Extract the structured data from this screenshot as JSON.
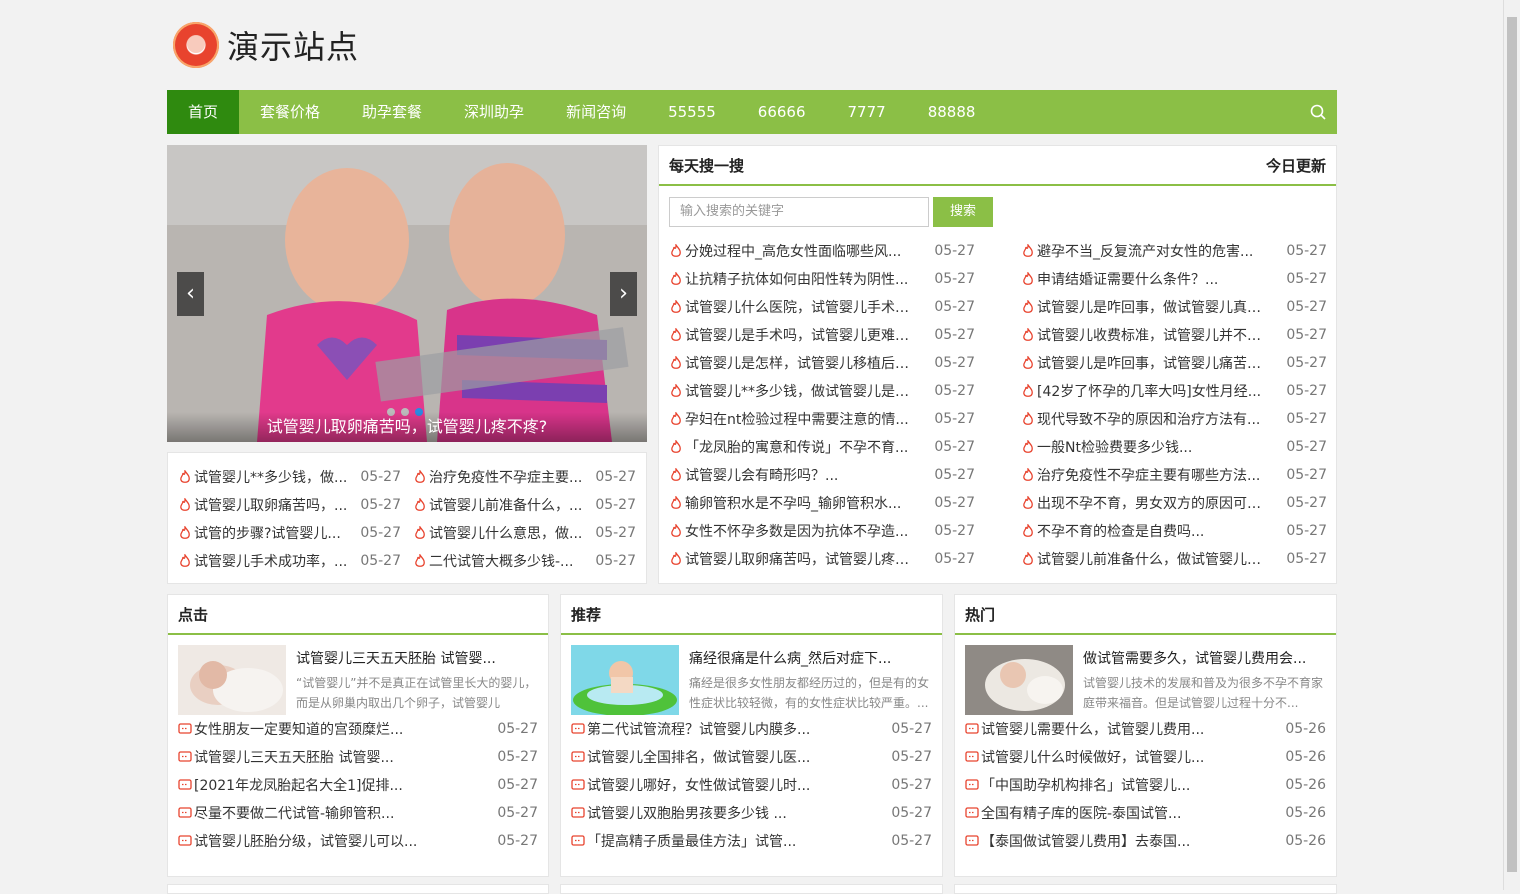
{
  "site": {
    "logo_text": "演示站点"
  },
  "nav": {
    "items": [
      "首页",
      "套餐价格",
      "助孕套餐",
      "深圳助孕",
      "新闻咨询",
      "55555",
      "66666",
      "7777",
      "88888"
    ]
  },
  "slider": {
    "caption": "试管婴儿取卵痛苦吗，试管婴儿疼不疼?",
    "prev": "‹",
    "next": "›"
  },
  "slider_list": [
    {
      "title": "试管婴儿**多少钱，做...",
      "date": "05-27"
    },
    {
      "title": "治疗免疫性不孕症主要...",
      "date": "05-27"
    },
    {
      "title": "试管婴儿取卵痛苦吗，...",
      "date": "05-27"
    },
    {
      "title": "试管婴儿前准备什么，...",
      "date": "05-27"
    },
    {
      "title": "试管的步骤?试管婴儿...",
      "date": "05-27"
    },
    {
      "title": "试管婴儿什么意思，做...",
      "date": "05-27"
    },
    {
      "title": "试管婴儿手术成功率，...",
      "date": "05-27"
    },
    {
      "title": "二代试管大概多少钱-...",
      "date": "05-27"
    }
  ],
  "daily": {
    "title": "每天搜一搜",
    "update": "今日更新",
    "search_placeholder": "输入搜索的关键字",
    "search_button": "搜索",
    "left": [
      {
        "title": "分娩过程中_高危女性面临哪些风...",
        "date": "05-27"
      },
      {
        "title": "让抗精子抗体如何由阳性转为阴性...",
        "date": "05-27"
      },
      {
        "title": "试管婴儿什么医院，试管婴儿手术总...",
        "date": "05-27"
      },
      {
        "title": "试管婴儿是手术吗，试管婴儿更难敷...",
        "date": "05-27"
      },
      {
        "title": "试管婴儿是怎样，试管婴儿移植后腹...",
        "date": "05-27"
      },
      {
        "title": "试管婴儿**多少钱，做试管婴儿是不...",
        "date": "05-27"
      },
      {
        "title": "孕妇在nt检验过程中需要注意的情...",
        "date": "05-27"
      },
      {
        "title": "「龙凤胎的寓意和传说」不孕不育...",
        "date": "05-27"
      },
      {
        "title": "试管婴儿会有畸形吗？...",
        "date": "05-27"
      },
      {
        "title": "输卵管积水是不孕吗_输卵管积水...",
        "date": "05-27"
      },
      {
        "title": "女性不怀孕多数是因为抗体不孕造...",
        "date": "05-27"
      },
      {
        "title": "试管婴儿取卵痛苦吗，试管婴儿疼不...",
        "date": "05-27"
      }
    ],
    "right": [
      {
        "title": "避孕不当_反复流产对女性的危害...",
        "date": "05-27"
      },
      {
        "title": "申请结婚证需要什么条件？...",
        "date": "05-27"
      },
      {
        "title": "试管婴儿是咋回事，做试管婴儿真的...",
        "date": "05-27"
      },
      {
        "title": "试管婴儿收费标准，试管婴儿并不可...",
        "date": "05-27"
      },
      {
        "title": "试管婴儿是咋回事，试管婴儿痛苦与...",
        "date": "05-27"
      },
      {
        "title": "[42岁了怀孕的几率大吗]女性月经...",
        "date": "05-27"
      },
      {
        "title": "现代导致不孕的原因和治疗方法有...",
        "date": "05-27"
      },
      {
        "title": "一般Nt检验费要多少钱...",
        "date": "05-27"
      },
      {
        "title": "治疗免疫性不孕症主要有哪些方法...",
        "date": "05-27"
      },
      {
        "title": "出现不孕不育，男女双方的原因可能...",
        "date": "05-27"
      },
      {
        "title": "不孕不育的检查是自费吗...",
        "date": "05-27"
      },
      {
        "title": "试管婴儿前准备什么，做试管婴儿有...",
        "date": "05-27"
      }
    ]
  },
  "columns": [
    {
      "title": "点击",
      "feature": {
        "title": "试管婴儿三天五天胚胎 试管婴...",
        "desc": "“试管婴儿”并不是真正在试管里长大的婴儿，而是从卵巢内取出几个卵子，试管婴儿"
      },
      "items": [
        {
          "title": "女性朋友一定要知道的宫颈糜烂...",
          "date": "05-27"
        },
        {
          "title": "试管婴儿三天五天胚胎 试管婴...",
          "date": "05-27"
        },
        {
          "title": "[2021年龙凤胎起名大全1]促排...",
          "date": "05-27"
        },
        {
          "title": "尽量不要做二代试管-输卵管积...",
          "date": "05-27"
        },
        {
          "title": "试管婴儿胚胎分级，试管婴儿可以...",
          "date": "05-27"
        }
      ]
    },
    {
      "title": "推荐",
      "feature": {
        "title": "痛经很痛是什么病_然后对症下...",
        "desc": "痛经是很多女性朋友都经历过的，但是有的女性症状比较轻微，有的女性症状比较严重。..."
      },
      "items": [
        {
          "title": "第二代试管流程？试管婴儿内膜多...",
          "date": "05-27"
        },
        {
          "title": "试管婴儿全国排名，做试管婴儿医...",
          "date": "05-27"
        },
        {
          "title": "试管婴儿哪好，女性做试管婴儿时...",
          "date": "05-27"
        },
        {
          "title": "试管婴儿双胞胎男孩要多少钱 ...",
          "date": "05-27"
        },
        {
          "title": "「提高精子质量最佳方法」试管...",
          "date": "05-27"
        }
      ]
    },
    {
      "title": "热门",
      "feature": {
        "title": "做试管需要多久，试管婴儿费用会...",
        "desc": "试管婴儿技术的发展和普及为很多不孕不育家庭带来福音。但是试管婴儿过程十分不..."
      },
      "items": [
        {
          "title": "试管婴儿需要什么，试管婴儿费用...",
          "date": "05-26"
        },
        {
          "title": "试管婴儿什么时候做好，试管婴儿...",
          "date": "05-26"
        },
        {
          "title": "「中国助孕机构排名」试管婴儿...",
          "date": "05-26"
        },
        {
          "title": "全国有精子库的医院-泰国试管...",
          "date": "05-26"
        },
        {
          "title": "【泰国做试管婴儿费用】去泰国...",
          "date": "05-26"
        }
      ]
    }
  ],
  "colors": {
    "nav": "#8bbf46",
    "nav_active": "#2f8a0f",
    "icon_red": "#e8432e"
  }
}
